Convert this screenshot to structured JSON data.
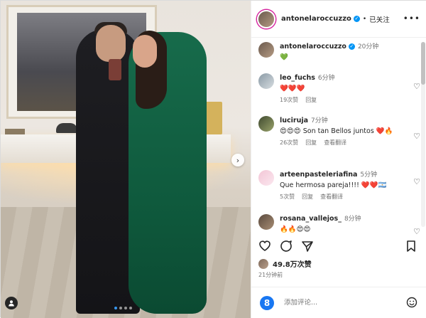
{
  "post": {
    "author": "antonelaroccuzzo",
    "follow_status": "已关注",
    "more": "•••",
    "next": "›",
    "tag_icon": "person-tag-icon",
    "carousel": {
      "count": 4,
      "active": 0
    }
  },
  "comments": [
    {
      "user": "antonelaroccuzzo",
      "verified": true,
      "time": "20分钟",
      "text": "💚",
      "likes": "",
      "reply": "",
      "translate": ""
    },
    {
      "user": "leo_fuchs",
      "verified": false,
      "time": "6分钟",
      "text": "❤️❤️❤️",
      "likes": "19次赞",
      "reply": "回复",
      "translate": ""
    },
    {
      "user": "luciruja",
      "verified": false,
      "time": "7分钟",
      "text": "😍😍😍 Son tan Bellos juntos ❤️🔥",
      "likes": "26次赞",
      "reply": "回复",
      "translate": "查看翻译"
    },
    {
      "user": "arteenpasteleriafina",
      "verified": false,
      "time": "5分钟",
      "text": "Que hermosa pareja!!!! ❤️❤️🇦🇷",
      "likes": "5次赞",
      "reply": "回复",
      "translate": "查看翻译"
    },
    {
      "user": "rosana_vallejos_",
      "verified": false,
      "time": "8分钟",
      "text": "🔥🔥😍😍",
      "likes": "",
      "reply": "",
      "translate": ""
    }
  ],
  "stats": {
    "likes": "49.8万次赞",
    "posted": "21分钟前"
  },
  "composer": {
    "placeholder": "添加评论...",
    "logo_text": "8"
  },
  "colors": {
    "verified": "#0095f6",
    "dress": "#0f5a3d",
    "story_ring": "#d6249f",
    "heart_red": "#ed4956"
  },
  "icons": [
    "heart-icon",
    "comment-icon",
    "share-icon",
    "bookmark-icon",
    "emoji-icon",
    "more-icon"
  ]
}
